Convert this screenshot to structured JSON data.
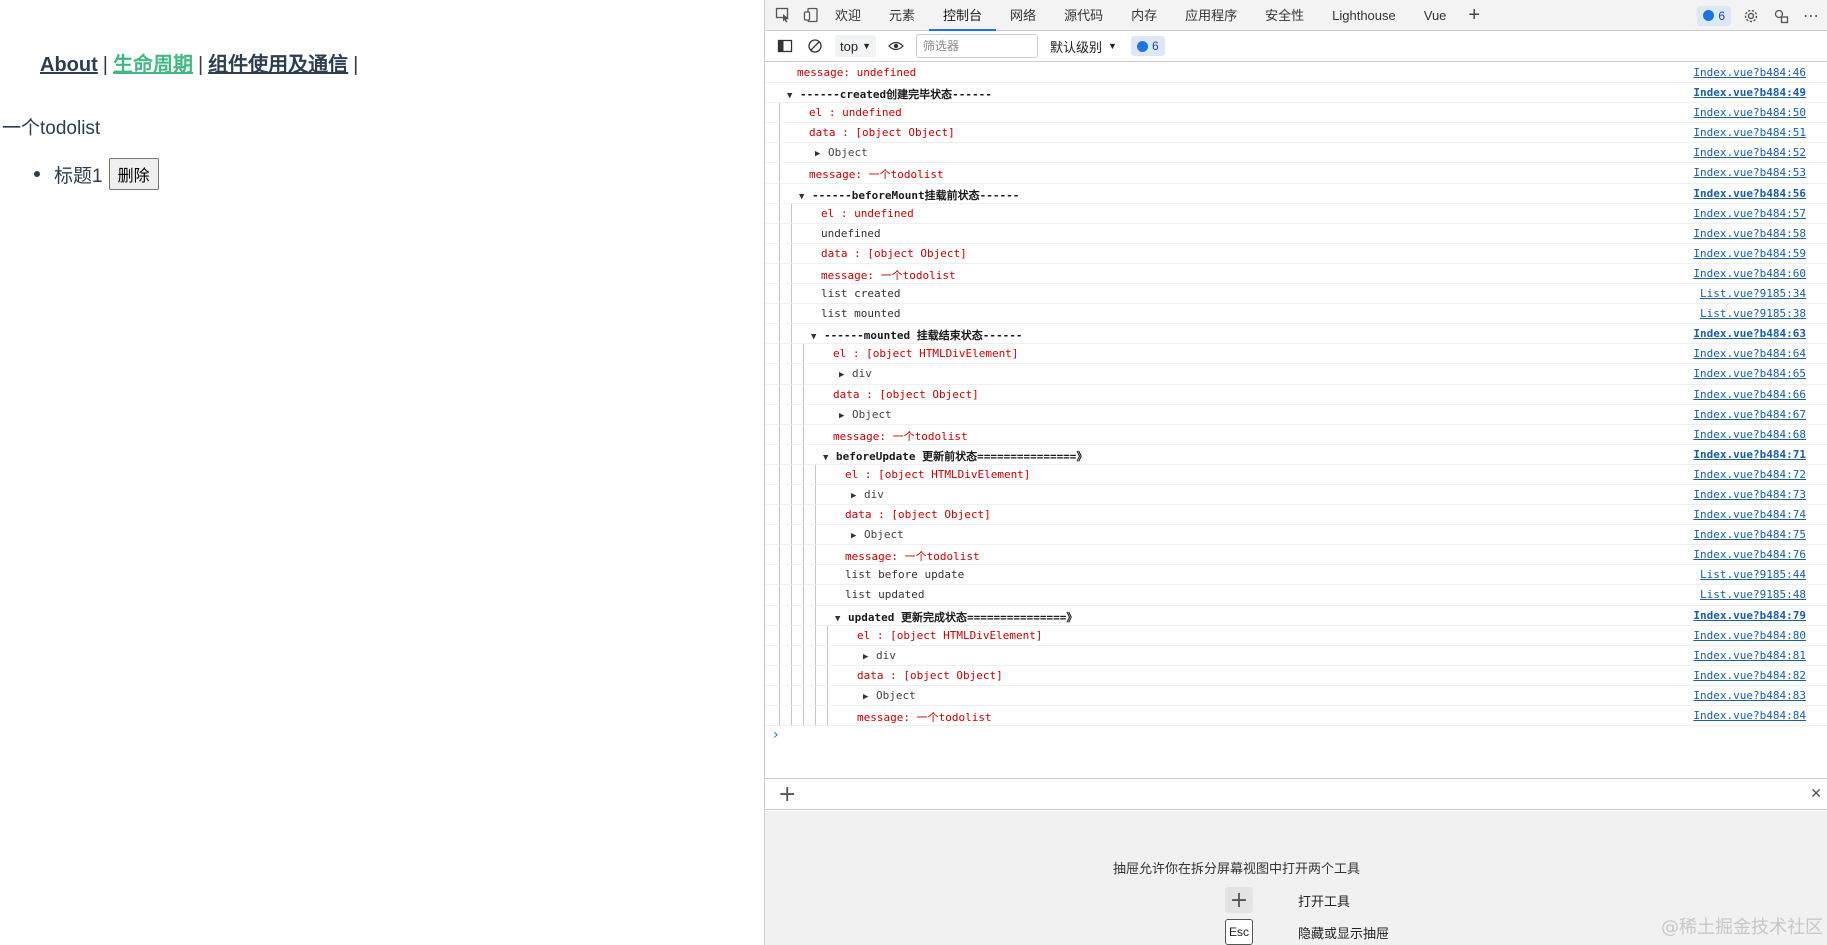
{
  "app": {
    "nav": [
      {
        "label": "About",
        "active": false
      },
      {
        "label": "生命周期",
        "active": true
      },
      {
        "label": "组件使用及通信",
        "active": false
      }
    ],
    "separator": "|",
    "title": "一个todolist",
    "todos": [
      {
        "label": "标题1",
        "button": "删除"
      }
    ],
    "colors": {
      "text": "#2c3e50",
      "active_link": "#42b983"
    }
  },
  "devtools": {
    "tabs": [
      {
        "label": "欢迎"
      },
      {
        "label": "元素"
      },
      {
        "label": "控制台",
        "active": true
      },
      {
        "label": "网络"
      },
      {
        "label": "源代码"
      },
      {
        "label": "内存"
      },
      {
        "label": "应用程序"
      },
      {
        "label": "安全性"
      },
      {
        "label": "Lighthouse"
      },
      {
        "label": "Vue"
      }
    ],
    "message_count": "6",
    "toolbar": {
      "context": "top",
      "filter_placeholder": "筛选器",
      "level": "默认级别",
      "issue_count": "6"
    },
    "log": [
      {
        "text": "message: undefined",
        "src": "Index.vue?b484:46",
        "style": "red",
        "depth": 0
      },
      {
        "text": "------created创建完毕状态------",
        "src": "Index.vue?b484:49",
        "style": "group",
        "depth": 0
      },
      {
        "text": "el     : undefined",
        "src": "Index.vue?b484:50",
        "style": "red",
        "depth": 1
      },
      {
        "text": "data   : [object Object]",
        "src": "Index.vue?b484:51",
        "style": "red",
        "depth": 1
      },
      {
        "text": "Object",
        "src": "Index.vue?b484:52",
        "style": "obj",
        "depth": 1
      },
      {
        "text": "message: 一个todolist",
        "src": "Index.vue?b484:53",
        "style": "red",
        "depth": 1
      },
      {
        "text": "------beforeMount挂载前状态------",
        "src": "Index.vue?b484:56",
        "style": "group",
        "depth": 1
      },
      {
        "text": "el     : undefined",
        "src": "Index.vue?b484:57",
        "style": "red",
        "depth": 2
      },
      {
        "text": "undefined",
        "src": "Index.vue?b484:58",
        "style": "plain",
        "depth": 2
      },
      {
        "text": "data   : [object Object]",
        "src": "Index.vue?b484:59",
        "style": "red",
        "depth": 2
      },
      {
        "text": "message: 一个todolist",
        "src": "Index.vue?b484:60",
        "style": "red",
        "depth": 2
      },
      {
        "text": "list created",
        "src": "List.vue?9185:34",
        "style": "plain",
        "depth": 2
      },
      {
        "text": "list mounted",
        "src": "List.vue?9185:38",
        "style": "plain",
        "depth": 2
      },
      {
        "text": "------mounted 挂载结束状态------",
        "src": "Index.vue?b484:63",
        "style": "group",
        "depth": 2
      },
      {
        "text": "el     : [object HTMLDivElement]",
        "src": "Index.vue?b484:64",
        "style": "red",
        "depth": 3
      },
      {
        "text": "div",
        "src": "Index.vue?b484:65",
        "style": "obj",
        "depth": 3
      },
      {
        "text": "data   : [object Object]",
        "src": "Index.vue?b484:66",
        "style": "red",
        "depth": 3
      },
      {
        "text": "Object",
        "src": "Index.vue?b484:67",
        "style": "obj",
        "depth": 3
      },
      {
        "text": "message: 一个todolist",
        "src": "Index.vue?b484:68",
        "style": "red",
        "depth": 3
      },
      {
        "text": "beforeUpdate 更新前状态===============》",
        "src": "Index.vue?b484:71",
        "style": "group",
        "depth": 3
      },
      {
        "text": "el     : [object HTMLDivElement]",
        "src": "Index.vue?b484:72",
        "style": "red",
        "depth": 4
      },
      {
        "text": "div",
        "src": "Index.vue?b484:73",
        "style": "obj",
        "depth": 4
      },
      {
        "text": "data   : [object Object]",
        "src": "Index.vue?b484:74",
        "style": "red",
        "depth": 4
      },
      {
        "text": "Object",
        "src": "Index.vue?b484:75",
        "style": "obj",
        "depth": 4
      },
      {
        "text": "message: 一个todolist",
        "src": "Index.vue?b484:76",
        "style": "red",
        "depth": 4
      },
      {
        "text": "list before update",
        "src": "List.vue?9185:44",
        "style": "plain",
        "depth": 4
      },
      {
        "text": "list updated",
        "src": "List.vue?9185:48",
        "style": "plain",
        "depth": 4
      },
      {
        "text": "updated 更新完成状态===============》",
        "src": "Index.vue?b484:79",
        "style": "group",
        "depth": 4
      },
      {
        "text": "el     : [object HTMLDivElement]",
        "src": "Index.vue?b484:80",
        "style": "red",
        "depth": 5
      },
      {
        "text": "div",
        "src": "Index.vue?b484:81",
        "style": "obj",
        "depth": 5
      },
      {
        "text": "data   : [object Object]",
        "src": "Index.vue?b484:82",
        "style": "red",
        "depth": 5
      },
      {
        "text": "Object",
        "src": "Index.vue?b484:83",
        "style": "obj",
        "depth": 5
      },
      {
        "text": "message: 一个todolist",
        "src": "Index.vue?b484:84",
        "style": "red",
        "depth": 5
      }
    ],
    "drawer": {
      "hint": "抽屉允许你在拆分屏幕视图中打开两个工具",
      "open_tool": "打开工具",
      "esc_key": "Esc",
      "toggle_drawer": "隐藏或显示抽屉"
    },
    "watermark": "@稀土掘金技术社区"
  }
}
